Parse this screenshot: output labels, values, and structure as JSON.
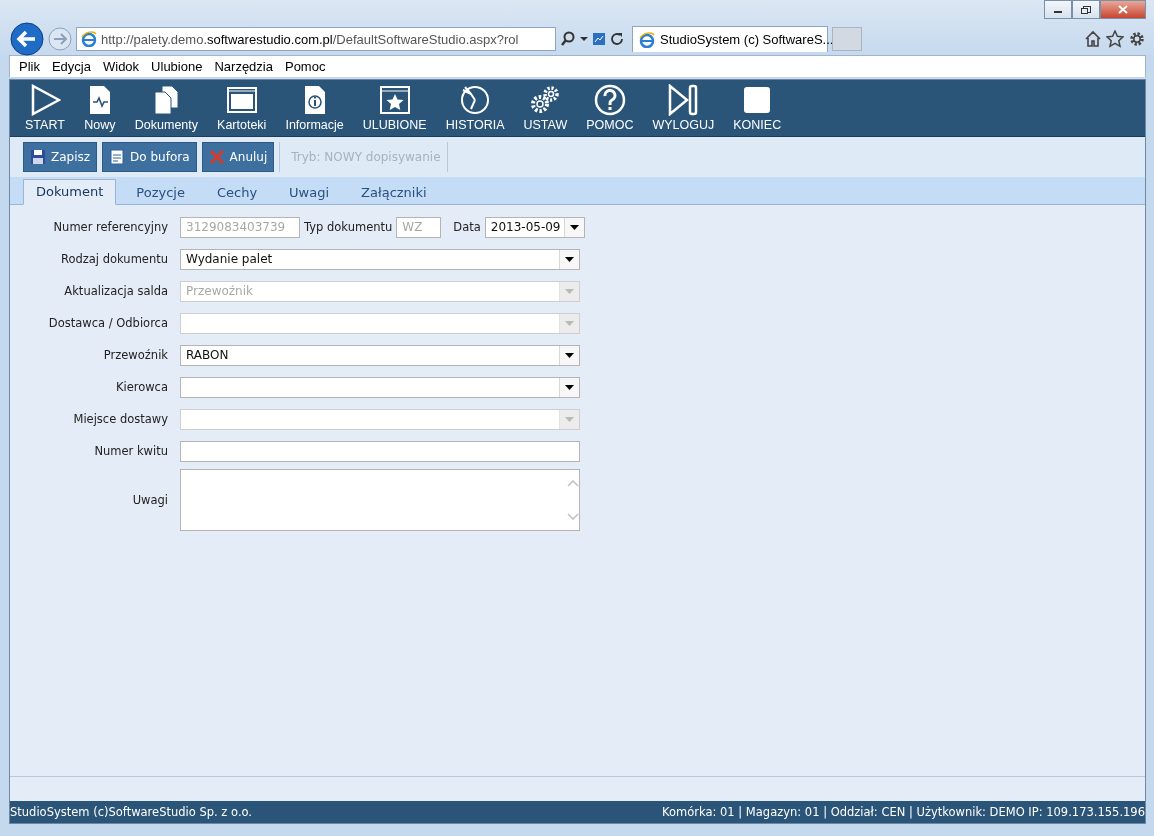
{
  "browser": {
    "address": "http://palety.demo.**softwarestudio.com.pl**/DefaultSoftwareStudio.aspx?rol",
    "tab_title": "StudioSystem (c) SoftwareS..."
  },
  "menu": [
    "Plik",
    "Edycja",
    "Widok",
    "Ulubione",
    "Narzędzia",
    "Pomoc"
  ],
  "toolbar": [
    {
      "label": "START",
      "kind": "start"
    },
    {
      "label": "Nowy",
      "kind": "new"
    },
    {
      "label": "Dokumenty",
      "kind": "documents"
    },
    {
      "label": "Kartoteki",
      "kind": "records"
    },
    {
      "label": "Informacje",
      "kind": "info"
    },
    {
      "label": "ULUBIONE",
      "kind": "favorites"
    },
    {
      "label": "HISTORIA",
      "kind": "history"
    },
    {
      "label": "USTAW",
      "kind": "settings"
    },
    {
      "label": "POMOC",
      "kind": "help"
    },
    {
      "label": "WYLOGUJ",
      "kind": "logout"
    },
    {
      "label": "KONIEC",
      "kind": "end"
    }
  ],
  "actions": [
    {
      "label": "Zapisz",
      "kind": "save"
    },
    {
      "label": "Do bufora",
      "kind": "buffer"
    },
    {
      "label": "Anuluj",
      "kind": "cancel"
    }
  ],
  "mode": {
    "text": "Tryb: NOWY dopisywanie",
    "disabled": true
  },
  "tabs": [
    {
      "label": "Dokument",
      "selected": true
    },
    {
      "label": "Pozycje",
      "selected": false
    },
    {
      "label": "Cechy",
      "selected": false
    },
    {
      "label": "Uwagi",
      "selected": false
    },
    {
      "label": "Załączniki",
      "selected": false
    }
  ],
  "form": {
    "header_fields": [
      {
        "label": "Numer referencyjny",
        "kind": "text",
        "value": "3129083403739",
        "disabled": true
      },
      {
        "label": "Typ dokumentu",
        "kind": "text",
        "value": "WZ",
        "disabled": true
      },
      {
        "label": "Data",
        "kind": "select",
        "value": "2013-05-09",
        "disabled": false
      }
    ],
    "rows": [
      {
        "label": "Rodzaj dokumentu",
        "kind": "select",
        "value": "Wydanie palet",
        "disabled": false
      },
      {
        "label": "Aktualizacja salda",
        "kind": "select",
        "value": "Przewoźnik",
        "disabled": true
      },
      {
        "label": "Dostawca / Odbiorca",
        "kind": "select",
        "disabled": true
      },
      {
        "label": "Przewoźnik",
        "kind": "select",
        "value": "RABON",
        "disabled": false
      },
      {
        "label": "Kierowca",
        "kind": "select",
        "disabled": false
      },
      {
        "label": "Miejsce dostawy",
        "kind": "select",
        "disabled": true
      },
      {
        "label": "Numer kwitu",
        "kind": "text"
      },
      {
        "label": "Uwagi",
        "kind": "textarea"
      }
    ]
  },
  "status_bar": {
    "left": "StudioSystem (c)SoftwareStudio Sp. z o.o.",
    "right": "Komórka: 01 | Magazyn: 01 | Oddział: CEN | Użytkownik: DEMO IP: 109.173.155.196"
  }
}
